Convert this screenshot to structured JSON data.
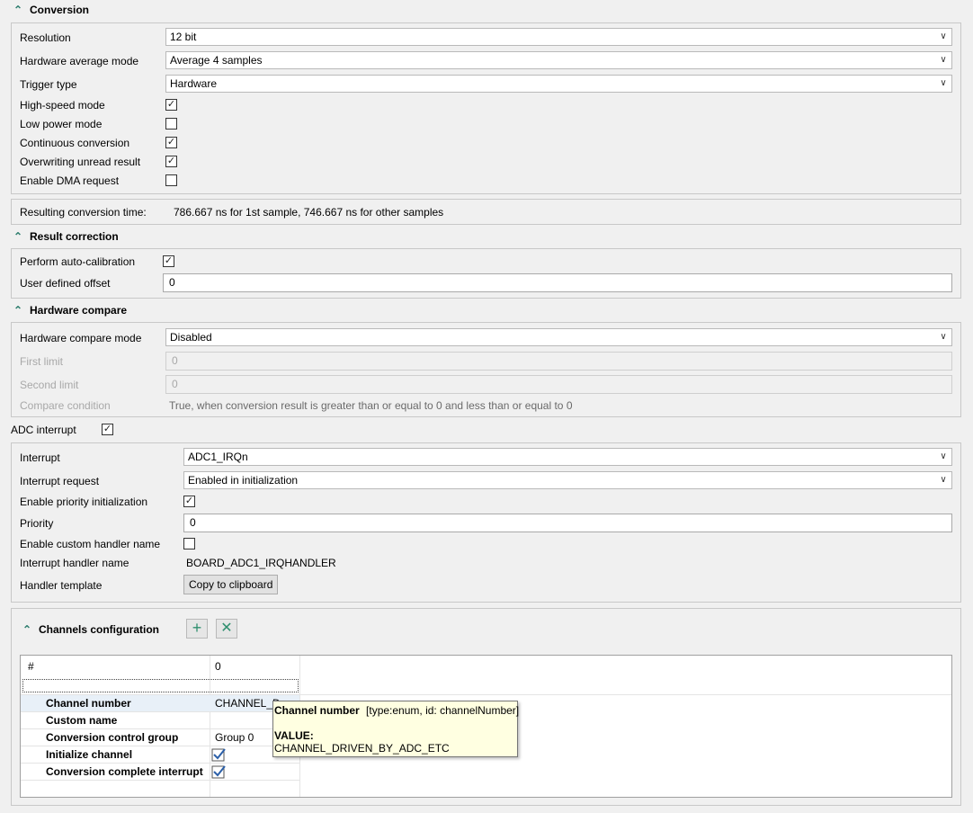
{
  "conversion": {
    "title": "Conversion",
    "resolution_label": "Resolution",
    "resolution_value": "12 bit",
    "hw_avg_label": "Hardware average mode",
    "hw_avg_value": "Average 4 samples",
    "trigger_label": "Trigger type",
    "trigger_value": "Hardware",
    "high_speed_label": "High-speed mode",
    "high_speed_checked": true,
    "low_power_label": "Low power mode",
    "low_power_checked": false,
    "continuous_label": "Continuous conversion",
    "continuous_checked": true,
    "overwriting_label": "Overwriting unread result",
    "overwriting_checked": true,
    "dma_label": "Enable DMA request",
    "dma_checked": false
  },
  "conversion_time": {
    "label": "Resulting conversion time:",
    "value": "786.667 ns for 1st sample, 746.667 ns for other samples"
  },
  "result_correction": {
    "title": "Result correction",
    "autocal_label": "Perform auto-calibration",
    "autocal_checked": true,
    "offset_label": "User defined offset",
    "offset_value": "0"
  },
  "hardware_compare": {
    "title": "Hardware compare",
    "mode_label": "Hardware compare mode",
    "mode_value": "Disabled",
    "first_limit_label": "First limit",
    "first_limit_value": "0",
    "second_limit_label": "Second limit",
    "second_limit_value": "0",
    "condition_label": "Compare condition",
    "condition_value": "True, when conversion result is greater than or equal to 0 and less than or equal to 0"
  },
  "adc_interrupt": {
    "label": "ADC interrupt",
    "checked": true,
    "interrupt_label": "Interrupt",
    "interrupt_value": "ADC1_IRQn",
    "request_label": "Interrupt request",
    "request_value": "Enabled in initialization",
    "priority_init_label": "Enable priority initialization",
    "priority_init_checked": true,
    "priority_label": "Priority",
    "priority_value": "0",
    "custom_handler_label": "Enable custom handler name",
    "custom_handler_checked": false,
    "handler_name_label": "Interrupt handler name",
    "handler_name_value": "BOARD_ADC1_IRQHANDLER",
    "template_label": "Handler template",
    "copy_button": "Copy to clipboard"
  },
  "channels": {
    "title": "Channels configuration",
    "add_icon": "plus-icon",
    "remove_icon": "close-icon",
    "header_label": "#",
    "header_value": "0",
    "rows": [
      {
        "name": "Channel number",
        "value": "CHANNEL_D"
      },
      {
        "name": "Custom name",
        "value": ""
      },
      {
        "name": "Conversion control group",
        "value": "Group 0"
      },
      {
        "name": "Initialize channel",
        "checked": true
      },
      {
        "name": "Conversion complete interrupt",
        "checked": true
      }
    ]
  },
  "tooltip": {
    "title": "Channel number",
    "meta": "[type:enum, id: channelNumber]",
    "value_label": "VALUE:",
    "value": "CHANNEL_DRIVEN_BY_ADC_ETC"
  },
  "colors": {
    "accent": "#2f7f6f",
    "tooltip_bg": "#ffffe1"
  }
}
